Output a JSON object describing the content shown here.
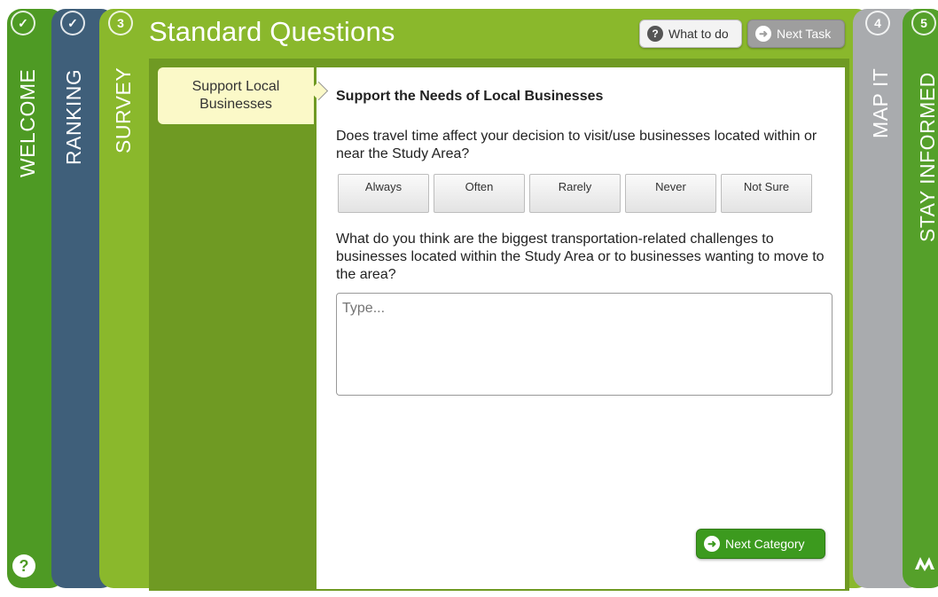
{
  "page": {
    "title": "Standard Questions"
  },
  "steps": [
    {
      "number": "✓",
      "label": "WELCOME",
      "status": "complete",
      "color": "#4e9a24"
    },
    {
      "number": "✓",
      "label": "RANKING",
      "status": "complete",
      "color": "#3f5f7a"
    },
    {
      "number": "3",
      "label": "SURVEY",
      "status": "active",
      "color": "#8ab82c"
    },
    {
      "number": "4",
      "label": "MAP IT",
      "status": "inactive",
      "color": "#a9abae"
    },
    {
      "number": "5",
      "label": "STAY INFORMED",
      "status": "inactive",
      "color": "#55a02a"
    }
  ],
  "header": {
    "what_to_do": {
      "label": "What to do",
      "icon": "question-icon"
    },
    "next_task": {
      "label": "Next Task",
      "icon": "arrow-right-icon"
    }
  },
  "category_tab": {
    "label": "Support Local Businesses"
  },
  "section": {
    "title": "Support the Needs of Local Businesses",
    "question1": "Does travel time affect your decision to visit/use businesses located within or near the Study Area?",
    "options": [
      "Always",
      "Often",
      "Rarely",
      "Never",
      "Not Sure"
    ],
    "question2": "What do you think are the biggest transportation-related challenges to businesses located within the Study Area or to businesses wanting to move to the area?",
    "answer_placeholder": "Type...",
    "answer_value": ""
  },
  "footer": {
    "next_category": {
      "label": "Next Category",
      "icon": "arrow-right-icon"
    },
    "help_icon": "question-icon",
    "logo_icon": "brand-logo-icon"
  },
  "colors": {
    "accent_green": "#8ab82c",
    "dark_green": "#4e9a24",
    "navy": "#3f5f7a",
    "gray": "#a9abae",
    "tab_yellow": "#fbf9c8"
  }
}
